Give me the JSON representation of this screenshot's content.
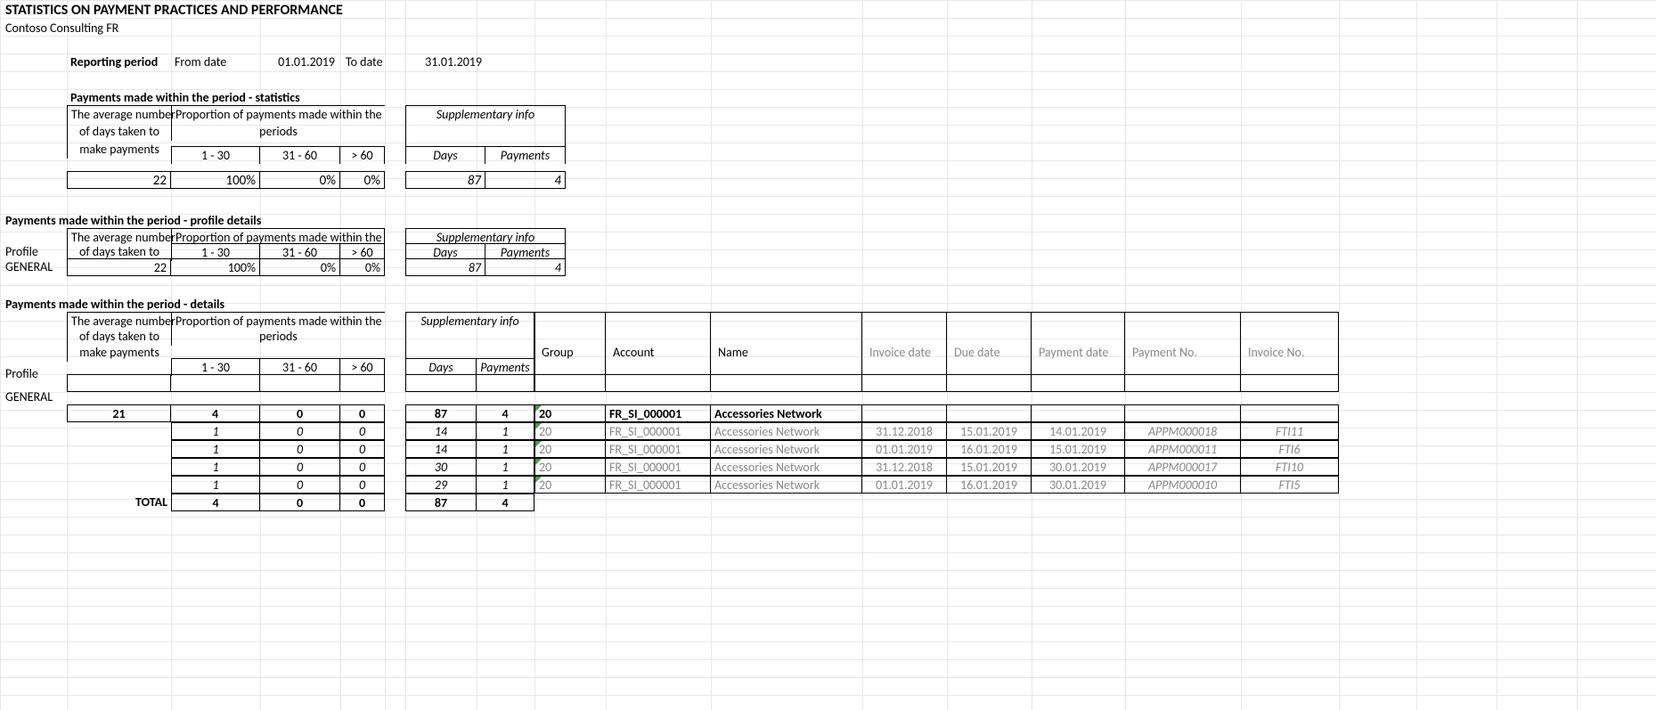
{
  "title": "STATISTICS ON PAYMENT PRACTICES AND PERFORMANCE",
  "company": "Contoso Consulting FR",
  "reporting": {
    "label": "Reporting period",
    "from_label": "From date",
    "from_value": "01.01.2019",
    "to_label": "To date",
    "to_value": "31.01.2019"
  },
  "section1": {
    "heading": "Payments made within the period - statistics",
    "col_avg_l1": "The average number",
    "col_avg_l2": "of days taken to",
    "col_avg_l3": "make payments",
    "col_prop_l1": "Proportion of payments made within the",
    "col_prop_l2": "periods",
    "col_1_30": "1 - 30",
    "col_31_60": "31 - 60",
    "col_gt60": "> 60",
    "col_supp": "Supplementary info",
    "col_days": "Days",
    "col_payments": "Payments",
    "val_avg": "22",
    "val_1_30": "100%",
    "val_31_60": "0%",
    "val_gt60": "0%",
    "val_days": "87",
    "val_payments": "4"
  },
  "section2": {
    "heading": "Payments made within the period - profile details",
    "profile_label": "Profile",
    "col_avg_l1": "The average number",
    "col_avg_l2": "of days taken to",
    "col_prop": "Proportion of payments made within the",
    "col_1_30": "1 - 30",
    "col_31_60": "31 - 60",
    "col_gt60": "> 60",
    "col_supp": "Supplementary info",
    "col_days": "Days",
    "col_payments": "Payments",
    "row_profile": "GENERAL",
    "row_avg": "22",
    "row_1_30": "100%",
    "row_31_60": "0%",
    "row_gt60": "0%",
    "row_days": "87",
    "row_payments": "4"
  },
  "section3": {
    "heading": "Payments made within the period - details",
    "profile_label": "Profile",
    "col_avg_l1": "The average number",
    "col_avg_l2": "of days taken to",
    "col_avg_l3": "make payments",
    "col_prop_l1": "Proportion of payments made within the",
    "col_prop_l2": "periods",
    "col_1_30": "1 - 30",
    "col_31_60": "31 - 60",
    "col_gt60": "> 60",
    "col_supp": "Supplementary info",
    "col_days": "Days",
    "col_payments": "Payments",
    "col_group": "Group",
    "col_account": "Account",
    "col_name": "Name",
    "col_invoice_date": "Invoice date",
    "col_due_date": "Due date",
    "col_payment_date": "Payment date",
    "col_payment_no": "Payment No.",
    "col_invoice_no": "Invoice No.",
    "row_profile": "GENERAL",
    "agg": {
      "avg": "21",
      "b1_30": "4",
      "b31_60": "0",
      "bgt60": "0",
      "days": "87",
      "payments": "4",
      "group": "20",
      "account": "FR_SI_000001",
      "name": "Accessories Network"
    },
    "rows": [
      {
        "b1_30": "1",
        "b31_60": "0",
        "bgt60": "0",
        "days": "14",
        "payments": "1",
        "group": "20",
        "account": "FR_SI_000001",
        "name": "Accessories Network",
        "invoice_date": "31.12.2018",
        "due_date": "15.01.2019",
        "payment_date": "14.01.2019",
        "payment_no": "APPM000018",
        "invoice_no": "FTI11"
      },
      {
        "b1_30": "1",
        "b31_60": "0",
        "bgt60": "0",
        "days": "14",
        "payments": "1",
        "group": "20",
        "account": "FR_SI_000001",
        "name": "Accessories Network",
        "invoice_date": "01.01.2019",
        "due_date": "16.01.2019",
        "payment_date": "15.01.2019",
        "payment_no": "APPM000011",
        "invoice_no": "FTI6"
      },
      {
        "b1_30": "1",
        "b31_60": "0",
        "bgt60": "0",
        "days": "30",
        "payments": "1",
        "group": "20",
        "account": "FR_SI_000001",
        "name": "Accessories Network",
        "invoice_date": "31.12.2018",
        "due_date": "15.01.2019",
        "payment_date": "30.01.2019",
        "payment_no": "APPM000017",
        "invoice_no": "FTI10"
      },
      {
        "b1_30": "1",
        "b31_60": "0",
        "bgt60": "0",
        "days": "29",
        "payments": "1",
        "group": "20",
        "account": "FR_SI_000001",
        "name": "Accessories Network",
        "invoice_date": "01.01.2019",
        "due_date": "16.01.2019",
        "payment_date": "30.01.2019",
        "payment_no": "APPM000010",
        "invoice_no": "FTI5"
      }
    ],
    "total_label": "TOTAL",
    "total": {
      "b1_30": "4",
      "b31_60": "0",
      "bgt60": "0",
      "days": "87",
      "payments": "4"
    }
  }
}
